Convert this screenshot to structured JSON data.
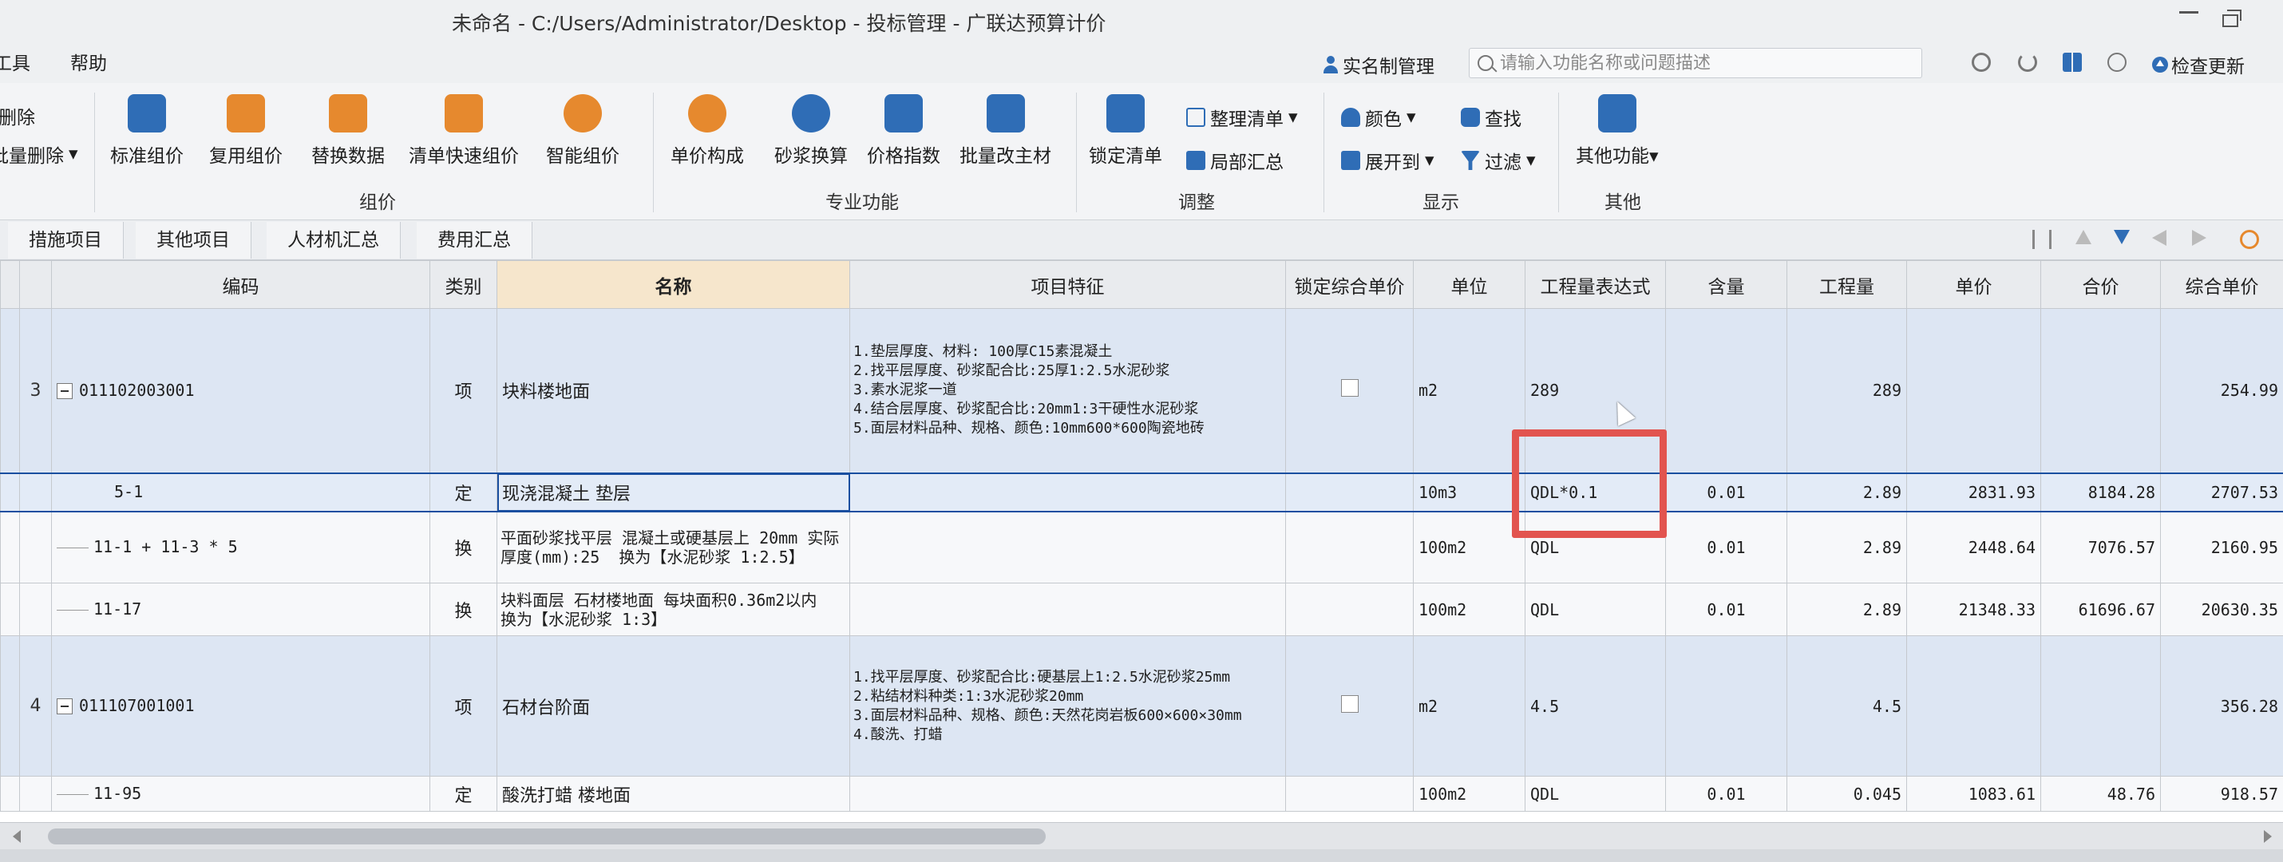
{
  "window": {
    "title": "未命名 - C:/Users/Administrator/Desktop - 投标管理 - 广联达预算计价"
  },
  "menu": {
    "items": [
      "工具",
      "帮助"
    ],
    "realname_label": "实名制管理",
    "search_placeholder": "请输入功能名称或问题描述",
    "check_update_label": "检查更新"
  },
  "ribbon": {
    "left_partial": {
      "delete_label": "删除",
      "batch_delete_label": "批量删除"
    },
    "groups": {
      "zujia": {
        "label": "组价",
        "buttons": [
          "标准组价",
          "复用组价",
          "替换数据",
          "清单快速组价",
          "智能组价"
        ]
      },
      "zhuanye": {
        "label": "专业功能",
        "buttons": [
          "单价构成",
          "砂浆换算",
          "价格指数",
          "批量改主材"
        ]
      },
      "tiaozheng": {
        "label": "调整",
        "buttons": [
          "锁定清单"
        ],
        "small": [
          "整理清单",
          "局部汇总"
        ]
      },
      "xianshi": {
        "label": "显示",
        "small": [
          "颜色",
          "查找",
          "展开到",
          "过滤"
        ]
      },
      "qita": {
        "label": "其他",
        "buttons": [
          "其他功能"
        ]
      }
    },
    "colors": {
      "accent_blue": "#2f6db6",
      "accent_orange": "#e6892e"
    }
  },
  "tabs": [
    "措施项目",
    "其他项目",
    "人材机汇总",
    "费用汇总"
  ],
  "grid": {
    "columns": [
      "编码",
      "类别",
      "名称",
      "项目特征",
      "锁定综合单价",
      "单位",
      "工程量表达式",
      "含量",
      "工程量",
      "单价",
      "合价",
      "综合单价"
    ],
    "rows": [
      {
        "num": "3",
        "code": "011102003001",
        "type": "项",
        "name": "块料楼地面",
        "feature": "1.垫层厚度、材料: 100厚C15素混凝土\n2.找平层厚度、砂浆配合比:25厚1:2.5水泥砂浆\n3.素水泥浆一道\n4.结合层厚度、砂浆配合比:20mm1:3干硬性水泥砂浆\n5.面层材料品种、规格、颜色:10mm600*600陶瓷地砖",
        "unit": "m2",
        "expr": "289",
        "content": "",
        "qty": "289",
        "price": "",
        "total": "",
        "comp": "254.99"
      },
      {
        "num": "",
        "code": "5-1",
        "type": "定",
        "name": "现浇混凝土 垫层",
        "feature": "",
        "unit": "10m3",
        "expr": "QDL*0.1",
        "content": "0.01",
        "qty": "2.89",
        "price": "2831.93",
        "total": "8184.28",
        "comp": "2707.53"
      },
      {
        "num": "",
        "code": "11-1 + 11-3 * 5",
        "type": "换",
        "name": "平面砂浆找平层 混凝土或硬基层上 20mm 实际厚度(mm):25  换为【水泥砂浆 1:2.5】",
        "feature": "",
        "unit": "100m2",
        "expr": "QDL",
        "content": "0.01",
        "qty": "2.89",
        "price": "2448.64",
        "total": "7076.57",
        "comp": "2160.95"
      },
      {
        "num": "",
        "code": "11-17",
        "type": "换",
        "name": "块料面层 石材楼地面 每块面积0.36m2以内  换为【水泥砂浆 1:3】",
        "feature": "",
        "unit": "100m2",
        "expr": "QDL",
        "content": "0.01",
        "qty": "2.89",
        "price": "21348.33",
        "total": "61696.67",
        "comp": "20630.35"
      },
      {
        "num": "4",
        "code": "011107001001",
        "type": "项",
        "name": "石材台阶面",
        "feature": "1.找平层厚度、砂浆配合比:硬基层上1:2.5水泥砂浆25mm\n2.粘结材料种类:1:3水泥砂浆20mm\n3.面层材料品种、规格、颜色:天然花岗岩板600×600×30mm\n4.酸洗、打蜡",
        "unit": "m2",
        "expr": "4.5",
        "content": "",
        "qty": "4.5",
        "price": "",
        "total": "",
        "comp": "356.28"
      },
      {
        "num": "",
        "code": "11-95",
        "type": "定",
        "name": "酸洗打蜡 楼地面",
        "feature": "",
        "unit": "100m2",
        "expr": "QDL",
        "content": "0.01",
        "qty": "0.045",
        "price": "1083.61",
        "total": "48.76",
        "comp": "918.57"
      }
    ]
  }
}
